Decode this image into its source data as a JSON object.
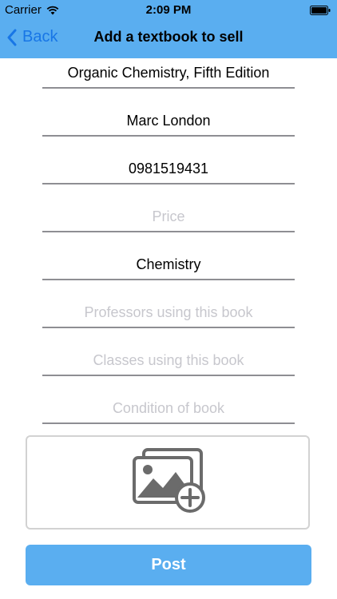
{
  "status_bar": {
    "carrier": "Carrier",
    "time": "2:09 PM"
  },
  "nav": {
    "back_label": "Back",
    "title": "Add a textbook to sell"
  },
  "form": {
    "title": {
      "value": "Organic Chemistry, Fifth Edition",
      "placeholder": ""
    },
    "author": {
      "value": "Marc London",
      "placeholder": ""
    },
    "isbn": {
      "value": "0981519431",
      "placeholder": ""
    },
    "price": {
      "value": "",
      "placeholder": "Price"
    },
    "subject": {
      "value": "Chemistry",
      "placeholder": ""
    },
    "professors": {
      "value": "",
      "placeholder": "Professors using this book"
    },
    "classes": {
      "value": "",
      "placeholder": "Classes using this book"
    },
    "condition": {
      "value": "",
      "placeholder": "Condition of book"
    }
  },
  "add_photo_icon": "add-image-icon",
  "post_label": "Post",
  "colors": {
    "nav_bg": "#5aaef0",
    "back_tint": "#1876e6",
    "field_line": "#8e8e93"
  }
}
